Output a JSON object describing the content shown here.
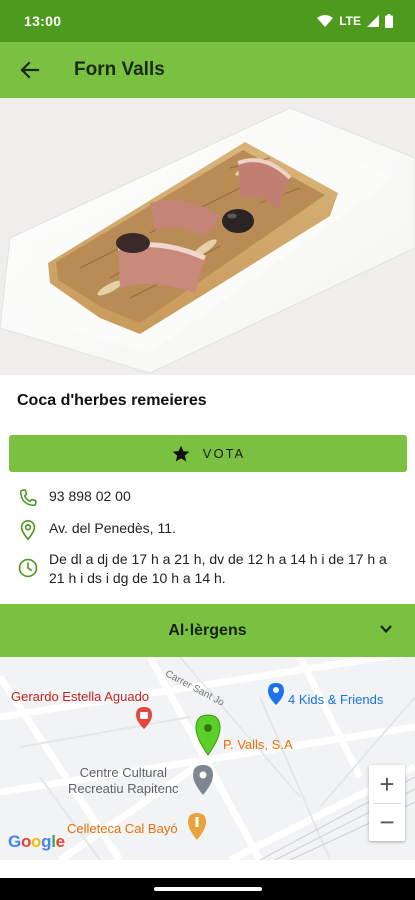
{
  "status_bar": {
    "time": "13:00",
    "network": "LTE",
    "icons": [
      "wifi-icon",
      "signal-icon",
      "battery-icon"
    ]
  },
  "app_bar": {
    "title": "Forn Valls",
    "back_icon": "arrow-left-icon"
  },
  "product": {
    "image_alt": "coca",
    "name": "Coca d'herbes remeieres"
  },
  "vote_button": {
    "label": "VOTA",
    "icon": "star-icon"
  },
  "info": {
    "phone": "93 898 02 00",
    "address": "Av. del Penedès, 11.",
    "hours": "De dl a dj de 17 h a 21 h, dv de 12 h a 14 h i de 17 h a 21 h  i ds i dg de 10 h a 14 h."
  },
  "allergens": {
    "label": "Al·lèrgens",
    "icon": "chevron-down-icon"
  },
  "map": {
    "pois": {
      "gerardo": "Gerardo Estella Aguado",
      "kids": "4 Kids & Friends",
      "marker": "P. Valls, S.A",
      "centre_line1": "Centre Cultural",
      "centre_line2": "Recreatiu Rapitenc",
      "celleteca": "Celleteca Cal Bayó"
    },
    "street": "Carrer Sant Jo",
    "zoom_in": "+",
    "zoom_out": "−",
    "logo": "Google"
  },
  "colors": {
    "status_bar": "#4d9a1e",
    "primary": "#7ac142",
    "icon_green": "#4d9a1e"
  }
}
